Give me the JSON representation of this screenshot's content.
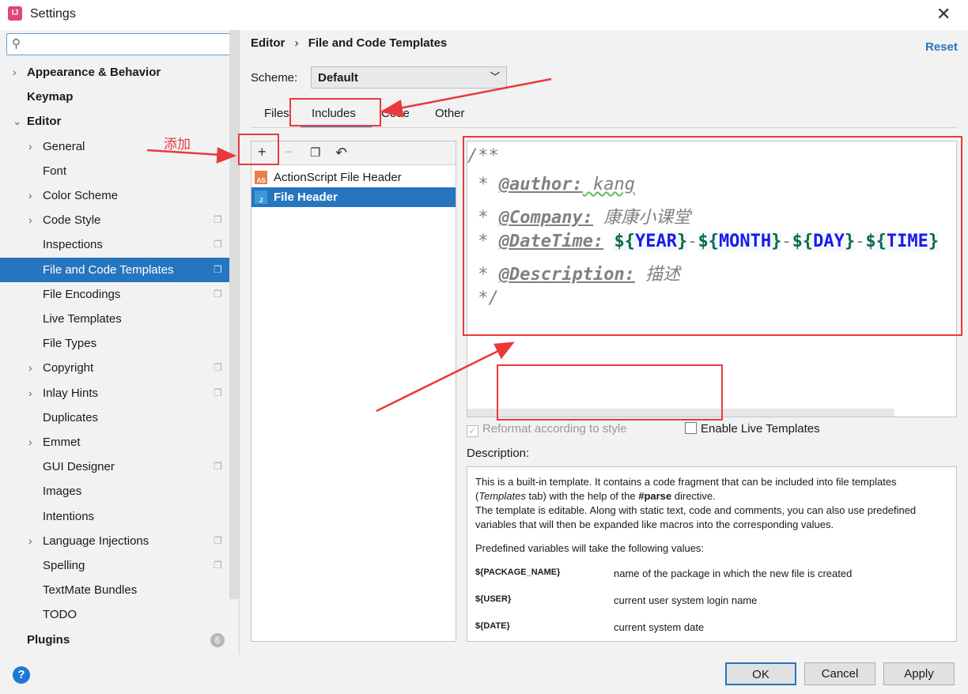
{
  "window": {
    "title": "Settings",
    "app_icon": "intellij-icon",
    "close_label": "✕"
  },
  "search": {
    "placeholder": "",
    "icon": "search-icon"
  },
  "sidebar": {
    "items": [
      {
        "label": "Appearance & Behavior",
        "level": 0,
        "chevron": true,
        "bold": true
      },
      {
        "label": "Keymap",
        "level": 0,
        "bold": true
      },
      {
        "label": "Editor",
        "level": 0,
        "chevron": "down",
        "bold": true
      },
      {
        "label": "General",
        "level": 1,
        "chevron": true
      },
      {
        "label": "Font",
        "level": 1
      },
      {
        "label": "Color Scheme",
        "level": 1,
        "chevron": true
      },
      {
        "label": "Code Style",
        "level": 1,
        "chevron": true,
        "copy": true
      },
      {
        "label": "Inspections",
        "level": 1,
        "copy": true
      },
      {
        "label": "File and Code Templates",
        "level": 1,
        "copy": true,
        "selected": true
      },
      {
        "label": "File Encodings",
        "level": 1,
        "copy": true
      },
      {
        "label": "Live Templates",
        "level": 1
      },
      {
        "label": "File Types",
        "level": 1
      },
      {
        "label": "Copyright",
        "level": 1,
        "chevron": true,
        "copy": true
      },
      {
        "label": "Inlay Hints",
        "level": 1,
        "chevron": true,
        "copy": true
      },
      {
        "label": "Duplicates",
        "level": 1
      },
      {
        "label": "Emmet",
        "level": 1,
        "chevron": true
      },
      {
        "label": "GUI Designer",
        "level": 1,
        "copy": true
      },
      {
        "label": "Images",
        "level": 1
      },
      {
        "label": "Intentions",
        "level": 1
      },
      {
        "label": "Language Injections",
        "level": 1,
        "chevron": true,
        "copy": true
      },
      {
        "label": "Spelling",
        "level": 1,
        "copy": true
      },
      {
        "label": "TextMate Bundles",
        "level": 1
      },
      {
        "label": "TODO",
        "level": 1
      },
      {
        "label": "Plugins",
        "level": 0,
        "bold": true,
        "badge": "6"
      }
    ]
  },
  "header": {
    "breadcrumb_parent": "Editor",
    "breadcrumb_sep": "›",
    "breadcrumb_current": "File and Code Templates",
    "reset": "Reset"
  },
  "scheme": {
    "label": "Scheme:",
    "value": "Default"
  },
  "tabs": [
    {
      "label": "Files"
    },
    {
      "label": "Includes",
      "active": true
    },
    {
      "label": "Code"
    },
    {
      "label": "Other"
    }
  ],
  "toolbar": {
    "add": "+",
    "remove": "−",
    "copy_icon": "copy-icon",
    "reset_icon": "undo-icon"
  },
  "templates": [
    {
      "name": "ActionScript File Header",
      "icon": "AS"
    },
    {
      "name": "File Header",
      "icon": "J",
      "selected": true
    }
  ],
  "editor": {
    "line1": "/**",
    "author_star": " * ",
    "author_tag": "@author:",
    "author_val": " kang",
    "company_tag": "@Company:",
    "company_val": " 康康小课堂",
    "datetime_tag": "@DateTime:",
    "vars": [
      "YEAR",
      "MONTH",
      "DAY",
      "TIME"
    ],
    "desc_tag": "@Description:",
    "desc_val": " 描述",
    "end": " */"
  },
  "options": {
    "reformat": "Reformat according to style",
    "reformat_checked": true,
    "live": "Enable Live Templates",
    "live_checked": false
  },
  "description": {
    "label": "Description:",
    "p1a": "This is a built-in template. It contains a code fragment that can be included into file templates (",
    "p1b": "Templates",
    "p1c": " tab) with the help of the ",
    "p1d": "#parse",
    "p1e": " directive.",
    "p2": "The template is editable. Along with static text, code and comments, you can also use predefined variables that will then be expanded like macros into the corresponding values.",
    "p3": "Predefined variables will take the following values:",
    "vars": [
      {
        "name": "${PACKAGE_NAME}",
        "desc": "name of the package in which the new file is created"
      },
      {
        "name": "${USER}",
        "desc": "current user system login name"
      },
      {
        "name": "${DATE}",
        "desc": "current system date"
      }
    ]
  },
  "buttons": {
    "ok": "OK",
    "cancel": "Cancel",
    "apply": "Apply",
    "help": "?"
  },
  "annotation": {
    "add_note": "添加",
    "color": "#e83a3a"
  },
  "colors": {
    "accent": "#2675bf",
    "annotation": "#e83a3a"
  }
}
